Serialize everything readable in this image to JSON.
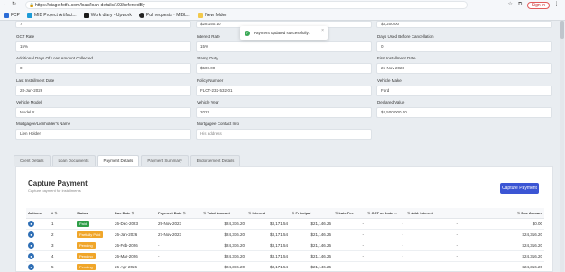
{
  "browser": {
    "url": "https://stage.fotfa.com/loan/loan-details/193/referredBy",
    "signin": "Sign in",
    "bookmarks": [
      "FCP",
      "MIB Project Artifact...",
      "Work diary - Upwork",
      "Pull requests · MIBL...",
      "New folder"
    ]
  },
  "form": {
    "row0": [
      "7",
      "$28,150.10",
      "$3,200.00"
    ],
    "fields": [
      {
        "label": "GCT Rate",
        "value": "15%"
      },
      {
        "label": "Interest Rate",
        "value": "15%"
      },
      {
        "label": "Days Used Before Cancellation",
        "value": "0"
      },
      {
        "label": "Additional Days Of Loan Amount Collected",
        "value": "0"
      },
      {
        "label": "Stamp Duty",
        "value": "$500.00"
      },
      {
        "label": "First Installment Date",
        "value": "26-Nov-2023"
      },
      {
        "label": "Last Installment Date",
        "value": "28-Jun-2026"
      },
      {
        "label": "Policy Number",
        "value": "FLCT-232-532-01"
      },
      {
        "label": "Vehicle Make",
        "value": "Ford"
      },
      {
        "label": "Vehicle Model",
        "value": "Model X"
      },
      {
        "label": "Vehicle Year",
        "value": "2023"
      },
      {
        "label": "Declared Value",
        "value": "$4,500,000.00"
      },
      {
        "label": "Mortgagee/Lienholder's Name",
        "value": "Lien Holder"
      },
      {
        "label": "Mortgagee Contact Info",
        "value": "His address"
      }
    ]
  },
  "toast": {
    "message": "Payment updated successfully."
  },
  "tabs": [
    "Client Details",
    "Loan Documents",
    "Payment Details",
    "Payment Summary",
    "Endorsement Details"
  ],
  "active_tab": 2,
  "card": {
    "title": "Capture Payment",
    "subtitle": "Capture payment for installments",
    "button": "Capture Payment"
  },
  "table": {
    "headers": [
      "Actions",
      "#",
      "Status",
      "Due Date",
      "Payment Date",
      "Total Amount",
      "Interest",
      "Principal",
      "Late Fee",
      "GCT on Late ...",
      "Add. Interest",
      "Due Amount"
    ],
    "rows": [
      [
        "1",
        "Paid",
        "26-Dec-2023",
        "29-Nov-2023",
        "$24,316.20",
        "$3,171.54",
        "$21,146.26",
        "-",
        "-",
        "-",
        "$0.00"
      ],
      [
        "2",
        "Partially Paid",
        "26-Jan-2026",
        "27-Nov-2023",
        "$24,316.20",
        "$3,171.54",
        "$21,146.26",
        "-",
        "-",
        "-",
        "$24,316.20"
      ],
      [
        "3",
        "Pending",
        "26-Feb-2026",
        "-",
        "$24,316.20",
        "$3,171.54",
        "$21,146.26",
        "-",
        "-",
        "-",
        "$24,316.20"
      ],
      [
        "4",
        "Pending",
        "26-Mar-2026",
        "-",
        "$24,316.20",
        "$3,171.54",
        "$21,146.26",
        "-",
        "-",
        "-",
        "$24,316.20"
      ],
      [
        "5",
        "Pending",
        "26-Apr-2026",
        "-",
        "$24,316.20",
        "$3,171.54",
        "$21,146.26",
        "-",
        "-",
        "-",
        "$24,316.20"
      ]
    ],
    "status_colors": {
      "Paid": "#2e9e48",
      "Partially Paid": "#f0a62a",
      "Pending": "#f0a62a"
    }
  },
  "colors": {
    "accent": "#3b55d4",
    "success": "#3aa856"
  }
}
